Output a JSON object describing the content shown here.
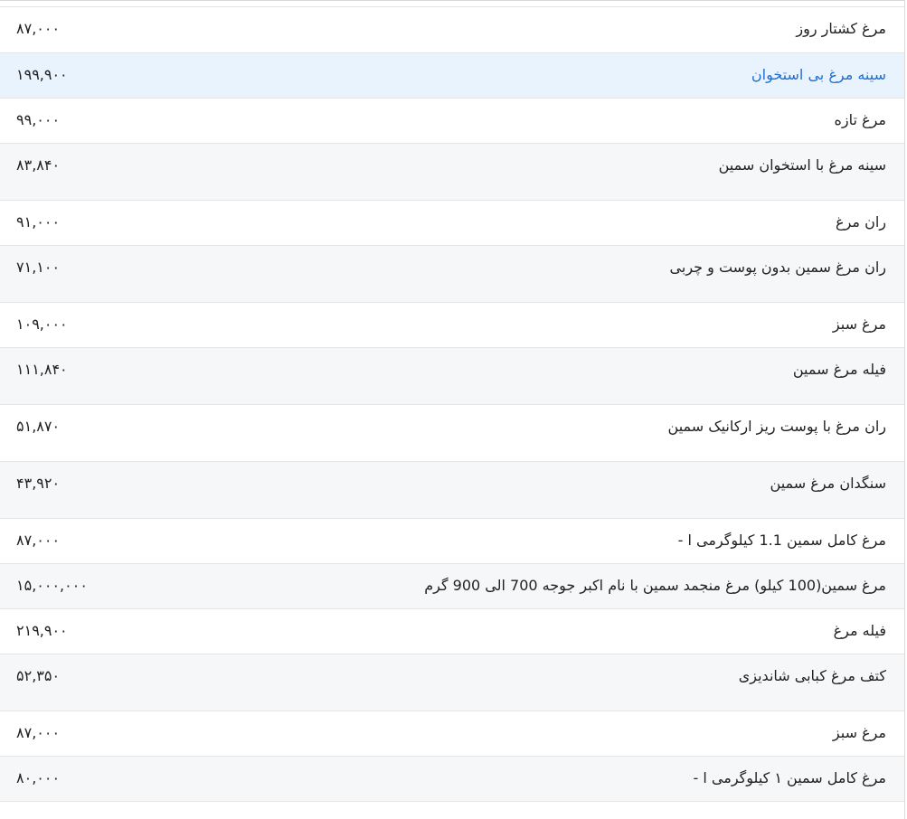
{
  "table": {
    "rows": [
      {
        "name": "مرغ کشتار روز",
        "price": "۸۷,۰۰۰"
      },
      {
        "name": "سینه مرغ بی استخوان",
        "price": "۱۹۹,۹۰۰"
      },
      {
        "name": "مرغ تازه",
        "price": "۹۹,۰۰۰"
      },
      {
        "name": "سینه مرغ با استخوان سمین",
        "price": "۸۳,۸۴۰"
      },
      {
        "name": "ران مرغ",
        "price": "۹۱,۰۰۰"
      },
      {
        "name": "ران مرغ سمین بدون پوست و چربی",
        "price": "۷۱,۱۰۰"
      },
      {
        "name": "مرغ سبز",
        "price": "۱۰۹,۰۰۰"
      },
      {
        "name": "فیله مرغ سمین",
        "price": "۱۱۱,۸۴۰"
      },
      {
        "name": "ران مرغ با پوست ریز ارکانیک سمین",
        "price": "۵۱,۸۷۰"
      },
      {
        "name": "سنگدان مرغ سمین",
        "price": "۴۳,۹۲۰"
      },
      {
        "name": "مرغ کامل سمین 1.1 کیلوگرمی ا -",
        "price": "۸۷,۰۰۰"
      },
      {
        "name": "مرغ سمین(100 کیلو) مرغ منجمد سمین با نام اکبر جوجه 700 الی 900 گرم",
        "price": "۱۵,۰۰۰,۰۰۰"
      },
      {
        "name": "فیله مرغ",
        "price": "۲۱۹,۹۰۰"
      },
      {
        "name": "کتف مرغ کبابی شاندیزی",
        "price": "۵۲,۳۵۰"
      },
      {
        "name": "مرغ سبز",
        "price": "۸۷,۰۰۰"
      },
      {
        "name": "مرغ کامل سمین ۱ کیلوگرمی ا -",
        "price": "۸۰,۰۰۰"
      }
    ],
    "highlighted_row": 1
  },
  "colors": {
    "highlight_bg": "#e9f3fe",
    "highlight_text": "#1f6fd1",
    "stripe_bg": "#f6f7f9",
    "border": "#e4e4e4"
  }
}
